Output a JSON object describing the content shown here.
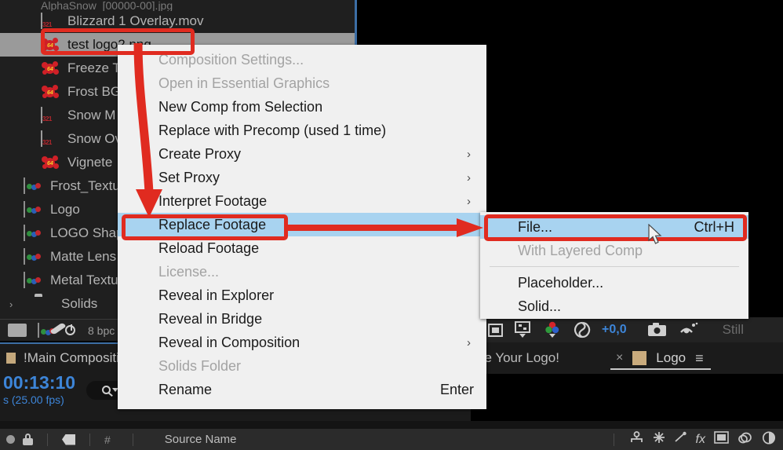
{
  "app": {
    "name": "Adobe After Effects"
  },
  "project_panel": {
    "items": [
      {
        "label": "AlphaSnow_[00000-00].jpg",
        "icon": "image-sequence-icon",
        "selected": false,
        "clipped": true,
        "indent": 1
      },
      {
        "label": "Blizzard 1 Overlay.mov",
        "icon": "movie-icon",
        "selected": false,
        "indent": 1
      },
      {
        "label": "test logo2.png",
        "icon": "star-footage-icon",
        "selected": true,
        "indent": 1
      },
      {
        "label": "Freeze T",
        "icon": "star-footage-icon",
        "selected": false,
        "indent": 1
      },
      {
        "label": "Frost BG",
        "icon": "star-footage-icon",
        "selected": false,
        "indent": 1
      },
      {
        "label": "Snow M",
        "icon": "movie-icon",
        "selected": false,
        "indent": 1
      },
      {
        "label": "Snow Ov",
        "icon": "movie-icon",
        "selected": false,
        "indent": 1
      },
      {
        "label": "Vignete",
        "icon": "star-footage-icon",
        "selected": false,
        "indent": 1
      },
      {
        "label": "Frost_Textu",
        "icon": "still-image-icon",
        "selected": false,
        "indent": 0
      },
      {
        "label": "Logo",
        "icon": "still-image-icon",
        "selected": false,
        "indent": 0
      },
      {
        "label": "LOGO Shape",
        "icon": "still-image-icon",
        "selected": false,
        "indent": 0
      },
      {
        "label": "Matte Lens",
        "icon": "still-image-icon",
        "selected": false,
        "indent": 0
      },
      {
        "label": "Metal Textu",
        "icon": "still-image-icon",
        "selected": false,
        "indent": 0
      },
      {
        "label": "Solids",
        "icon": "folder-icon",
        "selected": false,
        "indent": 0,
        "expandable": true
      }
    ],
    "toolbar": {
      "bit_depth": "8 bpc",
      "new_folder_name": "new-folder-icon",
      "new_comp_name": "new-composition-icon",
      "render_name": "project-settings-icon"
    }
  },
  "context_menu": {
    "items": [
      {
        "label": "Composition Settings...",
        "disabled": true,
        "submenu": false,
        "accel": ""
      },
      {
        "label": "Open in Essential Graphics",
        "disabled": true,
        "submenu": false,
        "accel": ""
      },
      {
        "label": "New Comp from Selection",
        "disabled": false,
        "submenu": false,
        "accel": ""
      },
      {
        "label": "Replace with Precomp (used 1 time)",
        "disabled": false,
        "submenu": false,
        "accel": ""
      },
      {
        "label": "Create Proxy",
        "disabled": false,
        "submenu": true,
        "accel": ""
      },
      {
        "label": "Set Proxy",
        "disabled": false,
        "submenu": true,
        "accel": ""
      },
      {
        "label": "Interpret Footage",
        "disabled": false,
        "submenu": true,
        "accel": ""
      },
      {
        "label": "Replace Footage",
        "disabled": false,
        "submenu": true,
        "accel": "",
        "highlighted": true
      },
      {
        "label": "Reload Footage",
        "disabled": false,
        "submenu": false,
        "accel": ""
      },
      {
        "label": "License...",
        "disabled": true,
        "submenu": false,
        "accel": ""
      },
      {
        "label": "Reveal in Explorer",
        "disabled": false,
        "submenu": false,
        "accel": ""
      },
      {
        "label": "Reveal in Bridge",
        "disabled": false,
        "submenu": false,
        "accel": ""
      },
      {
        "label": "Reveal in Composition",
        "disabled": false,
        "submenu": true,
        "accel": ""
      },
      {
        "label": "Solids Folder",
        "disabled": true,
        "submenu": false,
        "accel": ""
      },
      {
        "label": "Rename",
        "disabled": false,
        "submenu": false,
        "accel": "Enter"
      }
    ]
  },
  "submenu": {
    "items": [
      {
        "label": "File...",
        "accel": "Ctrl+H",
        "disabled": false,
        "highlighted": true
      },
      {
        "label": "With Layered Comp",
        "accel": "",
        "disabled": true,
        "highlighted": false
      },
      {
        "label": "Placeholder...",
        "accel": "",
        "disabled": false,
        "highlighted": false
      },
      {
        "label": "Solid...",
        "accel": "",
        "disabled": false,
        "highlighted": false
      }
    ]
  },
  "comp_panel": {
    "title": "!Main Composition",
    "timecode": "00:13:10",
    "fps": "s (25.00 fps)"
  },
  "viewer_toolbar": {
    "offset_value": "+0,0",
    "still_label": "Still"
  },
  "tabstrip": {
    "comp_tab_text": "ge Your Logo!",
    "close_glyph": "×",
    "layer_tab_label": "Logo",
    "menu_glyph": "≡"
  },
  "timeline_header": {
    "hash": "#",
    "source_name": "Source Name"
  },
  "annotations": {
    "accent_color": "#e02b20",
    "highlight_color": "#a8d3f0",
    "boxes": [
      {
        "name": "selected-footage-highlight"
      },
      {
        "name": "replace-footage-highlight"
      },
      {
        "name": "file-option-highlight"
      }
    ]
  }
}
